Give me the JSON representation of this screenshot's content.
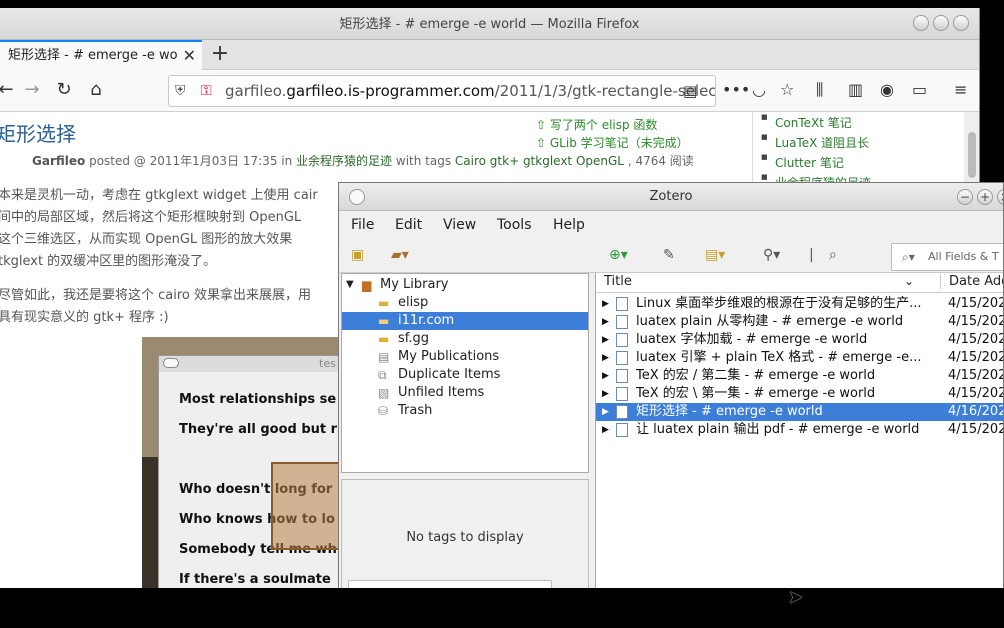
{
  "firefox": {
    "window_title": "矩形选择 - # emerge -e world — Mozilla Firefox",
    "tab_title": "矩形选择 - # emerge -e wo",
    "url_domain": "garfileo.is-programmer.com",
    "url_path": "/2011/1/3/gtk-rectangle-selecting-are",
    "url_prefix": "garfileo."
  },
  "post": {
    "title": "矩形选择",
    "author": "Garfileo",
    "meta_text": " posted @ 2011年1月03日 17:35 in ",
    "category": "业余程序猿的足迹",
    "tags_text": " with tags ",
    "tags": "Cairo gtk+ gtkglext OpenGL",
    "reads": " , 4764 阅读",
    "related": [
      "写了两个 elisp 函数",
      "GLib 学习笔记（未完成）"
    ],
    "paragraphs": [
      "本来是灵机一动，考虑在 gtkglext widget 上使用 cair",
      "间中的局部区域，然后将这个矩形框映射到 OpenGL",
      "这个三维选区，从而实现  OpenGL  图形的放大效果",
      "tkglext 的双缓冲区里的图形淹没了。",
      "尽管如此，我还是要将这个 cairo 效果拿出来展展，用",
      "具有现实意义的 gtk+ 程序 :)"
    ],
    "lyrics": [
      "Most relationships se",
      "They're all good but r",
      "Who doesn't long for",
      "Who knows how to lo",
      "Somebody tell me wh",
      "If there's a soulmate"
    ],
    "pic_window_title": "tes"
  },
  "sidebar": [
    "ConTeXt 笔记",
    "LuaTeX 道阻且长",
    "Clutter 笔记",
    "业余程序猿的足迹"
  ],
  "zotero": {
    "window_title": "Zotero",
    "menu": [
      "File",
      "Edit",
      "View",
      "Tools",
      "Help"
    ],
    "search_placeholder": "All Fields & T",
    "collections": [
      {
        "label": "My Library",
        "icon": "library-icon"
      },
      {
        "label": "elisp",
        "icon": "folder-icon"
      },
      {
        "label": "i11r.com",
        "icon": "folder-icon"
      },
      {
        "label": "sf.gg",
        "icon": "folder-icon"
      },
      {
        "label": "My Publications",
        "icon": "publications-icon"
      },
      {
        "label": "Duplicate Items",
        "icon": "duplicate-icon"
      },
      {
        "label": "Unfiled Items",
        "icon": "unfiled-icon"
      },
      {
        "label": "Trash",
        "icon": "trash-icon"
      }
    ],
    "selected_collection": "i11r.com",
    "no_tags": "No tags to display",
    "columns": {
      "title": "Title",
      "date": "Date Adde"
    },
    "items": [
      {
        "title": "Linux 桌面举步维艰的根源在于没有足够的生产...",
        "date": "4/15/202"
      },
      {
        "title": "luatex plain 从零构建 - # emerge -e world",
        "date": "4/15/202"
      },
      {
        "title": "luatex 字体加载 - # emerge -e world",
        "date": "4/15/202"
      },
      {
        "title": "luatex 引擎 + plain TeX 格式 - # emerge -e...",
        "date": "4/15/202"
      },
      {
        "title": "TeX 的宏 / 第二集 - # emerge -e world",
        "date": "4/15/202"
      },
      {
        "title": "TeX 的宏 \\ 第一集 - # emerge -e world",
        "date": "4/15/202"
      },
      {
        "title": "矩形选择 - # emerge -e world",
        "date": "4/16/202"
      },
      {
        "title": "让 luatex plain 输出 pdf - # emerge -e world",
        "date": "4/15/202"
      }
    ],
    "selected_item_index": 6
  }
}
